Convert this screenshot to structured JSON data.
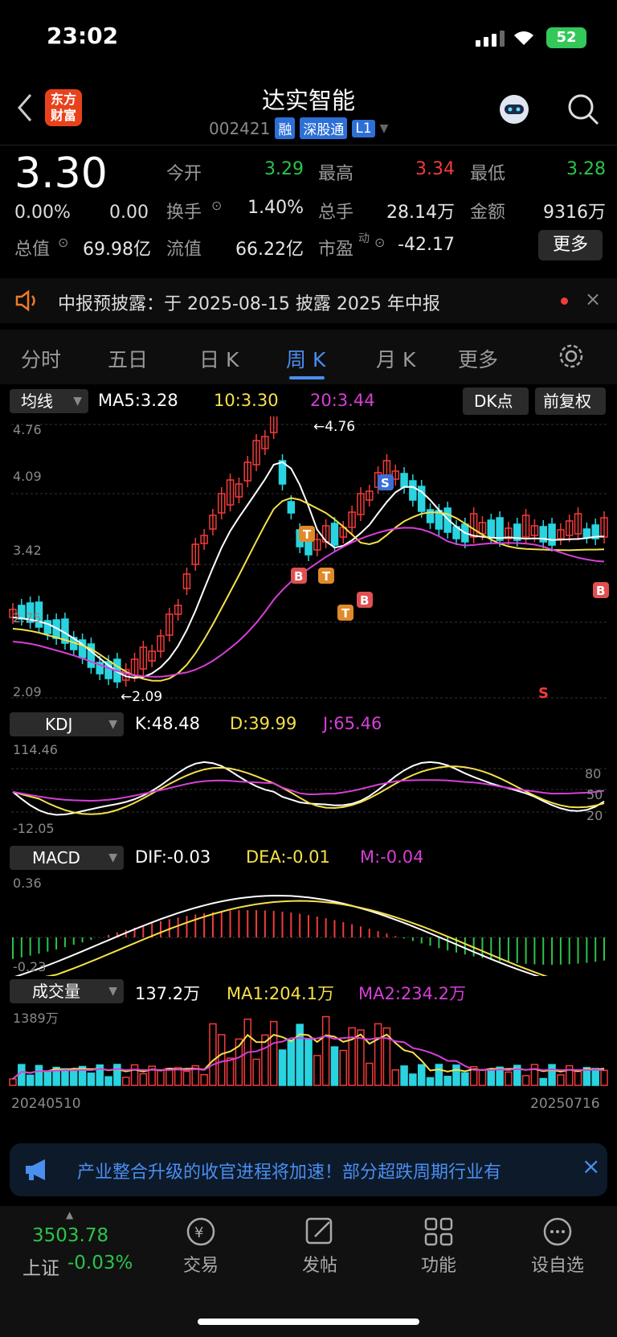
{
  "status_bar": {
    "time": "23:02",
    "battery": "52"
  },
  "header": {
    "title": "达实智能",
    "code": "002421",
    "logo_text": "东方财富",
    "tags": [
      "融",
      "深股通",
      "L1"
    ]
  },
  "quote": {
    "price": "3.30",
    "change_pct": "0.00%",
    "change": "0.00",
    "fields": [
      {
        "label": "今开",
        "value": "3.29"
      },
      {
        "label": "最高",
        "value": "3.34"
      },
      {
        "label": "最低",
        "value": "3.28"
      },
      {
        "label": "换手",
        "value": "1.40%"
      },
      {
        "label": "总手",
        "value": "28.14万"
      },
      {
        "label": "金额",
        "value": "9316万"
      },
      {
        "label": "总值",
        "value": "69.98亿"
      },
      {
        "label": "流值",
        "value": "66.22亿"
      },
      {
        "label": "市盈",
        "value": "-42.17"
      }
    ],
    "pe_superscript": "动",
    "more_label": "更多"
  },
  "notice": {
    "text": "中报预披露：于 2025-08-15 披露 2025 年中报"
  },
  "tabs": [
    "分时",
    "五日",
    "日 K",
    "周 K",
    "月 K",
    "更多"
  ],
  "chart_header": {
    "ma_selector": "均线",
    "ma5": "MA5:3.28",
    "ma10": "10:3.30",
    "ma20": "20:3.44",
    "dk_label": "DK点",
    "adjust_label": "前复权"
  },
  "chart_labels": {
    "price_axis": [
      "4.76",
      "4.09",
      "3.42",
      "2.75",
      "2.09"
    ],
    "max_marker": "←4.76",
    "min_marker": "←2.09",
    "kdj_selector": "KDJ",
    "kdj_k": "K:48.48",
    "kdj_d": "D:39.99",
    "kdj_j": "J:65.46",
    "kdj_axis_left": [
      "114.46",
      "-12.05"
    ],
    "kdj_axis_right": [
      "80",
      "50",
      "20"
    ],
    "macd_selector": "MACD",
    "macd_dif": "DIF:-0.03",
    "macd_dea": "DEA:-0.01",
    "macd_m": "M:-0.04",
    "macd_axis": [
      "0.36",
      "-0.23"
    ],
    "vol_selector": "成交量",
    "vol_value": "137.2万",
    "vol_ma1": "MA1:204.1万",
    "vol_ma2": "MA2:234.2万",
    "vol_axis": "1389万",
    "date_start": "20240510",
    "date_end": "20250716"
  },
  "chart_data": {
    "type": "candlestick",
    "x": [
      "20240510",
      "20250716"
    ],
    "ylim": [
      2.09,
      4.76
    ],
    "max": 4.76,
    "min": 2.09,
    "last_close": 3.3,
    "ma": {
      "MA5": 3.28,
      "MA10": 3.3,
      "MA20": 3.44
    }
  },
  "banner": {
    "text": "产业整合升级的收官进程将加速！部分超跌周期行业有"
  },
  "bottom_nav": {
    "index_value": "3503.78",
    "index_name": "上证",
    "index_change": "-0.03%",
    "items": [
      "交易",
      "发帖",
      "功能",
      "设自选"
    ]
  },
  "colors": {
    "up": "#f23b3b",
    "down": "#29d4e0",
    "accent": "#4a8ef0",
    "ma5": "#ffffff",
    "ma10": "#f5e04a",
    "ma20": "#d63fd6"
  }
}
